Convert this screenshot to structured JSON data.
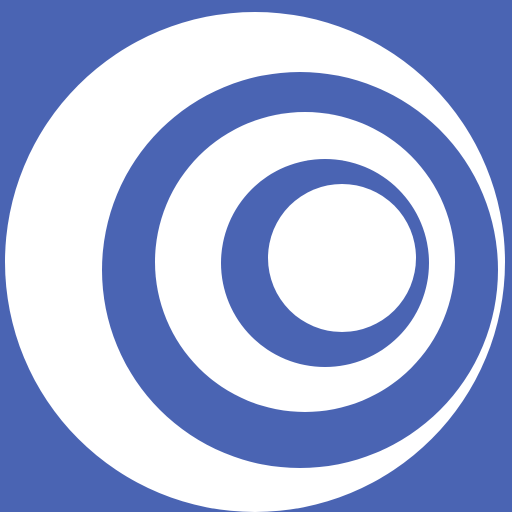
{
  "logo": {
    "icon": "concentric-crescent-logo-icon",
    "colors": {
      "background": "#4a64b3",
      "foreground": "#ffffff"
    }
  }
}
